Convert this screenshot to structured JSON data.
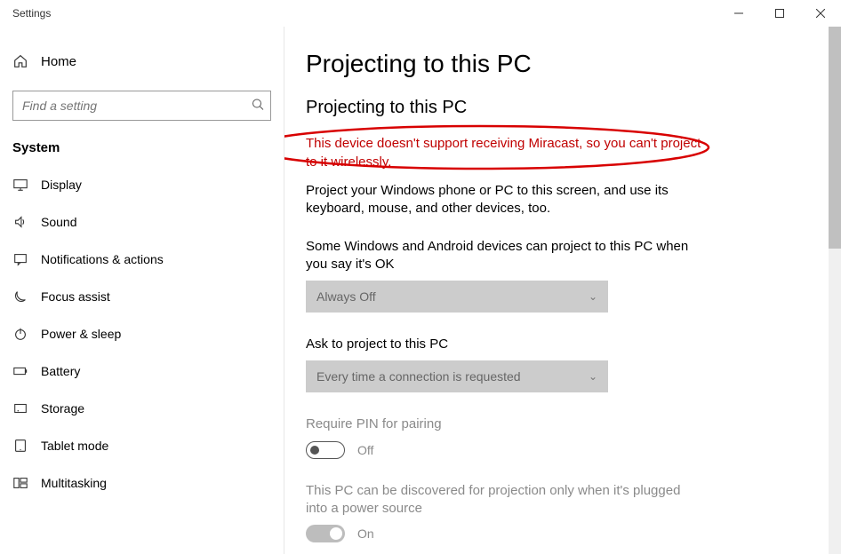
{
  "window": {
    "title": "Settings"
  },
  "sidebar": {
    "home": "Home",
    "search_placeholder": "Find a setting",
    "section": "System",
    "items": [
      {
        "label": "Display"
      },
      {
        "label": "Sound"
      },
      {
        "label": "Notifications & actions"
      },
      {
        "label": "Focus assist"
      },
      {
        "label": "Power & sleep"
      },
      {
        "label": "Battery"
      },
      {
        "label": "Storage"
      },
      {
        "label": "Tablet mode"
      },
      {
        "label": "Multitasking"
      }
    ]
  },
  "main": {
    "title": "Projecting to this PC",
    "subtitle": "Projecting to this PC",
    "error": "This device doesn't support receiving Miracast, so you can't project to it wirelessly.",
    "description": "Project your Windows phone or PC to this screen, and use its keyboard, mouse, and other devices, too.",
    "setting1_label": "Some Windows and Android devices can project to this PC when you say it's OK",
    "setting1_value": "Always Off",
    "setting2_label": "Ask to project to this PC",
    "setting2_value": "Every time a connection is requested",
    "setting3_label": "Require PIN for pairing",
    "setting3_value": "Off",
    "setting4_label": "This PC can be discovered for projection only when it's plugged into a power source",
    "setting4_value": "On"
  }
}
